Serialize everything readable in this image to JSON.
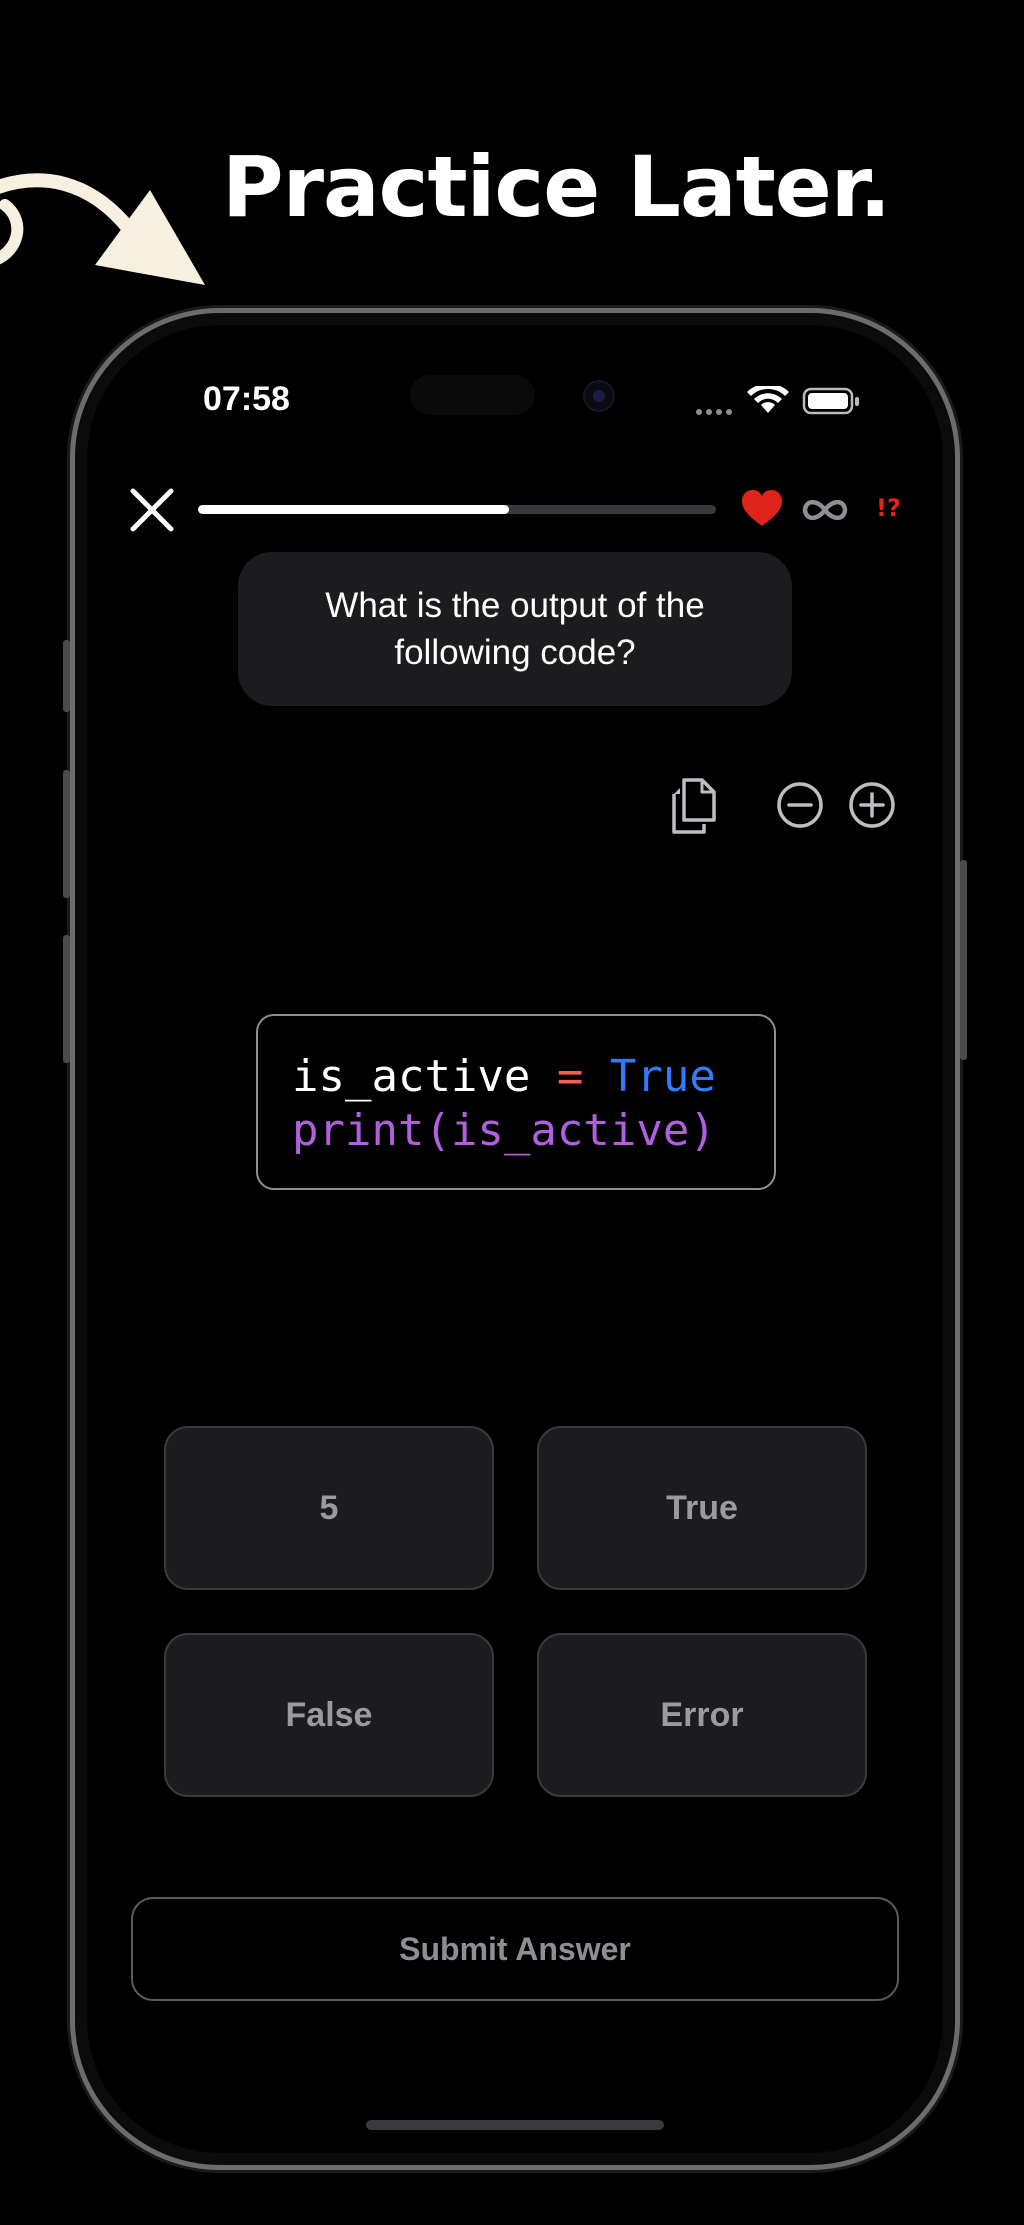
{
  "headline": "Practice Later.",
  "status_bar": {
    "time": "07:58"
  },
  "quiz": {
    "progress_fraction": 0.6,
    "lives": "∞",
    "hint_label": "!?",
    "question": "What is the output of the following code?",
    "code_lines": [
      [
        {
          "text": "is_active ",
          "kind": "plain"
        },
        {
          "text": "=",
          "kind": "op"
        },
        {
          "text": " ",
          "kind": "plain"
        },
        {
          "text": "True",
          "kind": "kw"
        }
      ],
      [
        {
          "text": "print(is_active)",
          "kind": "fn"
        }
      ]
    ],
    "options": [
      "5",
      "True",
      "False",
      "Error"
    ],
    "submit_label": "Submit Answer"
  },
  "colors": {
    "accent_red": "#e0241b",
    "keyword_blue": "#2f7cf6",
    "function_purple": "#b15fe0",
    "operator_red": "#ff5c57"
  }
}
